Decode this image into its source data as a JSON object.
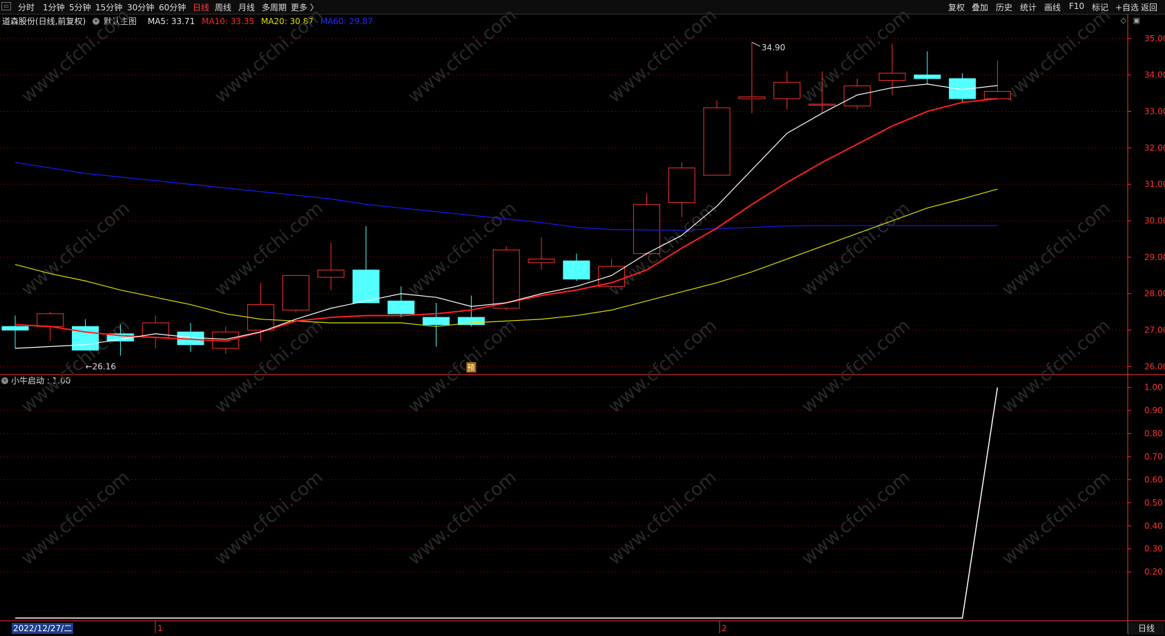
{
  "toolbar": {
    "icon": "window-menu-icon",
    "periods": [
      "分时",
      "1分钟",
      "5分钟",
      "15分钟",
      "30分钟",
      "60分钟",
      "日线",
      "周线",
      "月线",
      "多周期",
      "更多 〉"
    ],
    "active_period": "日线",
    "right_tools": [
      "复权",
      "叠加",
      "历史",
      "统计",
      "画线",
      "F10",
      "标记",
      "+自选",
      "返回"
    ]
  },
  "ma_legend": {
    "title": "道森股份(日线,前复权)",
    "main_chart": "默认主图",
    "ma5": "MA5: 33.71",
    "ma10": "MA10: 33.35",
    "ma20": "MA20: 30.87",
    "ma60": "MA60: 29.87"
  },
  "indicator_legend": {
    "text": "小牛启动 : 1.00"
  },
  "bottom": {
    "date_cursor": "2022/12/27/二",
    "tab": "日线",
    "month_markers": [
      "1",
      "2"
    ]
  },
  "annotations": {
    "high": "34.90",
    "low": "←26.16",
    "badge": "预"
  },
  "colors": {
    "up": "#ff3232",
    "down": "#54ffff",
    "ma5": "#ffffff",
    "ma10": "#ff2020",
    "ma20": "#e0e000",
    "ma60": "#1a1aff",
    "grid": "#6a0000",
    "axis": "#ff3232",
    "bg": "#000000"
  },
  "watermark": "www.cfchi.com",
  "chart_data": [
    {
      "type": "candlestick",
      "ylim": [
        25.8,
        35.3
      ],
      "yticks": [
        "35.00",
        "34.00",
        "33.00",
        "32.00",
        "31.00",
        "30.00",
        "29.00",
        "28.00",
        "27.00",
        "26.00"
      ],
      "candles": [
        {
          "o": 27.1,
          "h": 27.4,
          "l": 26.5,
          "c": 27.0
        },
        {
          "o": 27.1,
          "h": 27.5,
          "l": 26.7,
          "c": 27.45
        },
        {
          "o": 27.1,
          "h": 27.3,
          "l": 26.45,
          "c": 26.45
        },
        {
          "o": 26.9,
          "h": 27.15,
          "l": 26.3,
          "c": 26.7
        },
        {
          "o": 26.8,
          "h": 27.4,
          "l": 26.5,
          "c": 27.2
        },
        {
          "o": 26.95,
          "h": 27.2,
          "l": 26.4,
          "c": 26.6
        },
        {
          "o": 26.5,
          "h": 27.1,
          "l": 26.35,
          "c": 26.95
        },
        {
          "o": 27.0,
          "h": 28.3,
          "l": 26.7,
          "c": 27.7
        },
        {
          "o": 27.55,
          "h": 28.5,
          "l": 27.5,
          "c": 28.5
        },
        {
          "o": 28.45,
          "h": 29.4,
          "l": 28.1,
          "c": 28.65
        },
        {
          "o": 28.65,
          "h": 29.85,
          "l": 27.8,
          "c": 27.75
        },
        {
          "o": 27.8,
          "h": 28.2,
          "l": 27.35,
          "c": 27.45
        },
        {
          "o": 27.35,
          "h": 27.75,
          "l": 26.55,
          "c": 27.15
        },
        {
          "o": 27.35,
          "h": 27.95,
          "l": 27.1,
          "c": 27.15
        },
        {
          "o": 27.6,
          "h": 29.3,
          "l": 27.55,
          "c": 29.2
        },
        {
          "o": 28.85,
          "h": 29.55,
          "l": 28.65,
          "c": 28.95
        },
        {
          "o": 28.9,
          "h": 29.1,
          "l": 28.35,
          "c": 28.4
        },
        {
          "o": 28.2,
          "h": 28.95,
          "l": 28.15,
          "c": 28.75
        },
        {
          "o": 29.1,
          "h": 30.75,
          "l": 29.05,
          "c": 30.45
        },
        {
          "o": 30.5,
          "h": 31.6,
          "l": 30.1,
          "c": 31.45
        },
        {
          "o": 31.25,
          "h": 33.3,
          "l": 31.25,
          "c": 33.1
        },
        {
          "o": 33.35,
          "h": 34.9,
          "l": 32.95,
          "c": 33.4
        },
        {
          "o": 33.35,
          "h": 34.1,
          "l": 33.05,
          "c": 33.8
        },
        {
          "o": 33.2,
          "h": 34.1,
          "l": 32.95,
          "c": 33.2
        },
        {
          "o": 33.15,
          "h": 33.9,
          "l": 33.05,
          "c": 33.7
        },
        {
          "o": 33.85,
          "h": 34.85,
          "l": 33.45,
          "c": 34.05
        },
        {
          "o": 34.0,
          "h": 34.65,
          "l": 33.75,
          "c": 33.9
        },
        {
          "o": 33.9,
          "h": 34.05,
          "l": 33.25,
          "c": 33.35
        },
        {
          "o": 33.35,
          "h": 34.4,
          "l": 33.35,
          "c": 33.55
        }
      ],
      "ma5": [
        26.5,
        26.55,
        26.6,
        26.75,
        26.9,
        26.8,
        26.75,
        26.95,
        27.3,
        27.6,
        27.8,
        28.0,
        27.9,
        27.65,
        27.75,
        28.0,
        28.2,
        28.5,
        29.1,
        29.6,
        30.4,
        31.4,
        32.4,
        32.95,
        33.45,
        33.65,
        33.75,
        33.6,
        33.71
      ],
      "ma10": [
        27.15,
        27.1,
        26.95,
        26.85,
        26.8,
        26.75,
        26.7,
        26.95,
        27.25,
        27.35,
        27.4,
        27.4,
        27.45,
        27.55,
        27.75,
        27.95,
        28.1,
        28.3,
        28.65,
        29.25,
        29.8,
        30.45,
        31.05,
        31.6,
        32.1,
        32.6,
        33.0,
        33.25,
        33.35
      ],
      "ma20": [
        28.8,
        28.55,
        28.35,
        28.1,
        27.9,
        27.7,
        27.45,
        27.3,
        27.25,
        27.2,
        27.2,
        27.2,
        27.1,
        27.2,
        27.25,
        27.3,
        27.4,
        27.55,
        27.8,
        28.05,
        28.3,
        28.6,
        28.95,
        29.3,
        29.65,
        30.0,
        30.35,
        30.6,
        30.87
      ],
      "ma60": [
        31.6,
        31.45,
        31.3,
        31.2,
        31.1,
        31.0,
        30.9,
        30.8,
        30.7,
        30.6,
        30.45,
        30.35,
        30.25,
        30.15,
        30.05,
        29.95,
        29.82,
        29.76,
        29.75,
        29.74,
        29.78,
        29.82,
        29.86,
        29.87,
        29.87,
        29.87,
        29.87,
        29.87,
        29.87
      ]
    },
    {
      "type": "line",
      "name": "小牛启动",
      "ylim": [
        0,
        1.05
      ],
      "yticks": [
        "1.00",
        "0.90",
        "0.80",
        "0.70",
        "0.60",
        "0.50",
        "0.40",
        "0.30",
        "0.20"
      ],
      "values": [
        0,
        0,
        0,
        0,
        0,
        0,
        0,
        0,
        0,
        0,
        0,
        0,
        0,
        0,
        0,
        0,
        0,
        0,
        0,
        0,
        0,
        0,
        0,
        0,
        0,
        0,
        0,
        0,
        1
      ]
    }
  ]
}
